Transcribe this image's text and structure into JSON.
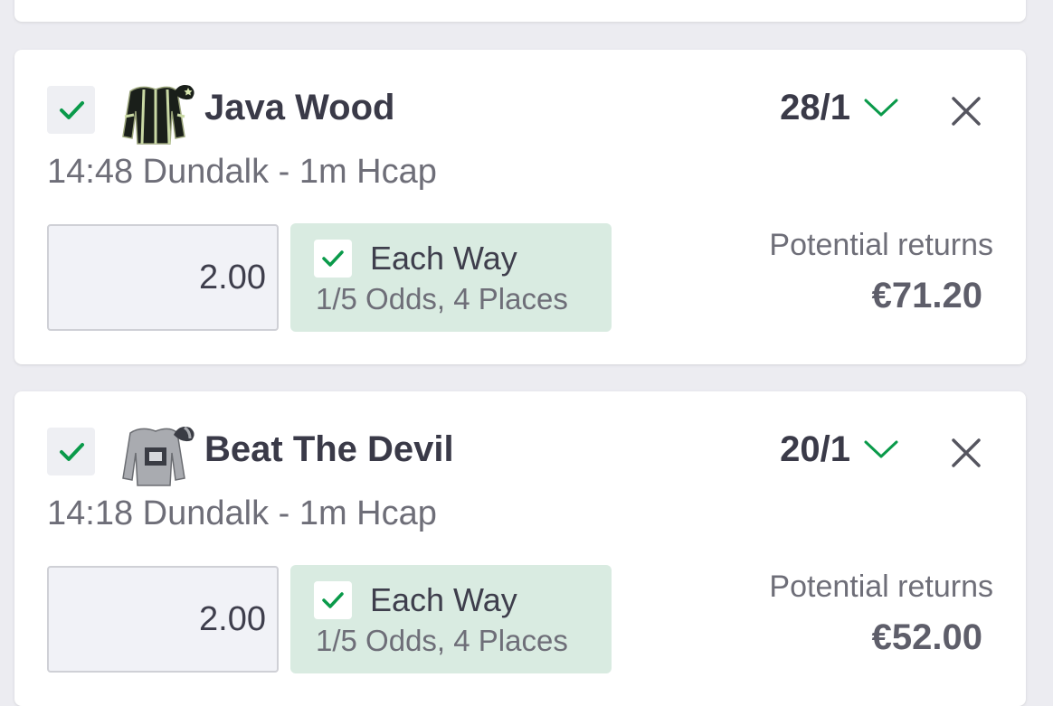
{
  "colors": {
    "accent_green": "#0a9a4a",
    "each_way_bg": "#d9ebe1",
    "card_bg": "#ffffff",
    "page_bg": "#ececf1"
  },
  "bets": [
    {
      "horse_name": "Java Wood",
      "odds": "28/1",
      "race_info": "14:48 Dundalk - 1m Hcap",
      "stake": "2.00",
      "each_way_label": "Each Way",
      "each_way_terms": "1/5 Odds, 4 Places",
      "returns_label": "Potential returns",
      "returns_value": "€71.20",
      "selected": true,
      "each_way_checked": true,
      "silk_icon": "black-green-stripes-silk-icon"
    },
    {
      "horse_name": "Beat The Devil",
      "odds": "20/1",
      "race_info": "14:18 Dundalk - 1m Hcap",
      "stake": "2.00",
      "each_way_label": "Each Way",
      "each_way_terms": "1/5 Odds, 4 Places",
      "returns_label": "Potential returns",
      "returns_value": "€52.00",
      "selected": true,
      "each_way_checked": true,
      "silk_icon": "grey-square-silk-icon"
    }
  ]
}
